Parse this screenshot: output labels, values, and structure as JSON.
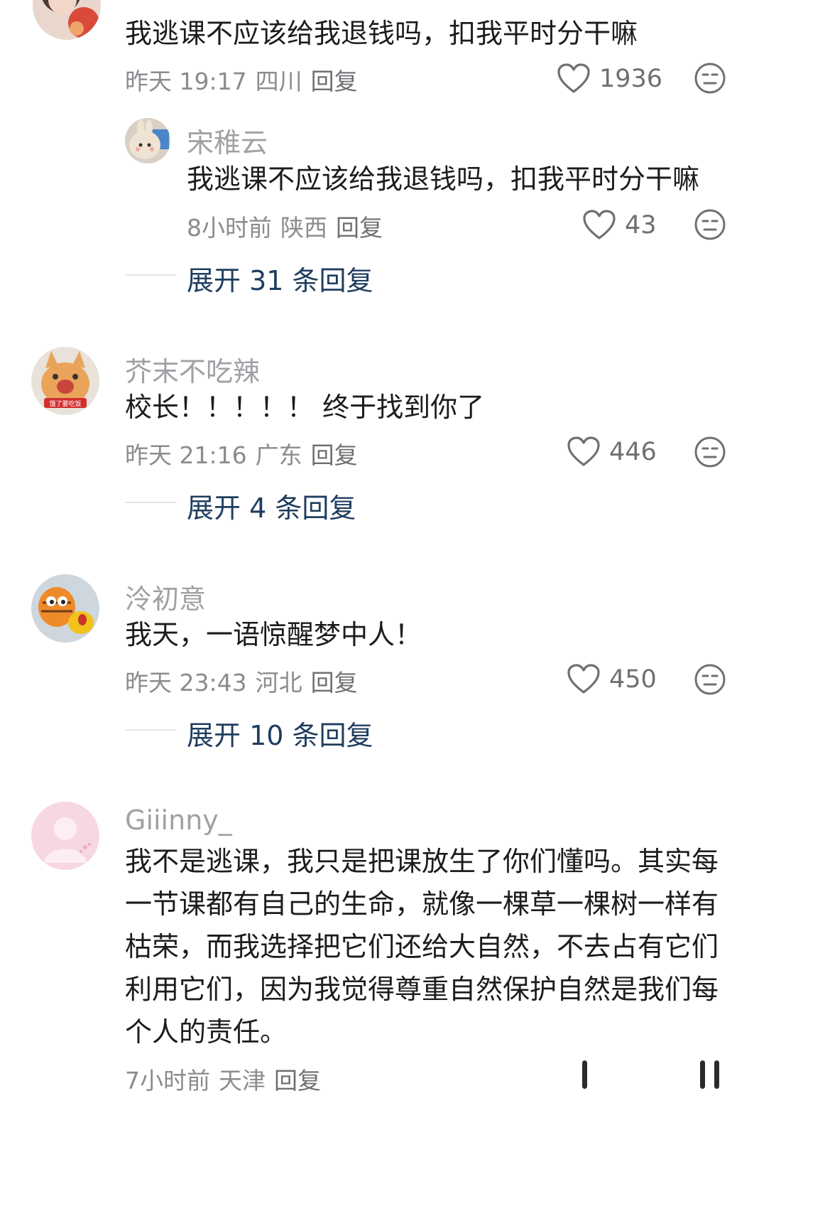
{
  "comments": [
    {
      "name": "",
      "text": "我逃课不应该给我退钱吗，扣我平时分干嘛",
      "time": "昨天 19:17",
      "location": "四川",
      "reply_label": "回复",
      "likes": "1936",
      "reply": {
        "name": "宋稚云",
        "text": "我逃课不应该给我退钱吗，扣我平时分干嘛",
        "time": "8小时前",
        "location": "陕西",
        "reply_label": "回复",
        "likes": "43"
      },
      "expand": "展开 31 条回复"
    },
    {
      "name": "芥末不吃辣",
      "avatar_caption": "饿了要吃饭",
      "text": "校长！！！！！ 终于找到你了",
      "time": "昨天 21:16",
      "location": "广东",
      "reply_label": "回复",
      "likes": "446",
      "expand": "展开 4 条回复"
    },
    {
      "name": "泠初意",
      "text": "我天，一语惊醒梦中人！",
      "time": "昨天 23:43",
      "location": "河北",
      "reply_label": "回复",
      "likes": "450",
      "expand": "展开 10 条回复"
    },
    {
      "name": "Giiinny_",
      "text_lines": [
        "我不是逃课，我只是把课放生了你们懂吗。其实每",
        "一节课都有自己的生命，就像一棵草一棵树一样有",
        "枯荣，而我选择把它们还给大自然，不去占有它们",
        "利用它们，因为我觉得尊重自然保护自然是我们每",
        "个人的责任。"
      ],
      "time": "7小时前",
      "location": "天津",
      "reply_label": "回复"
    }
  ],
  "icons": {
    "like": "heart-outline-icon",
    "dislike": "dislike-face-icon"
  },
  "colors": {
    "name_gray": "#a0a0a5",
    "meta_gray": "#8b8b90",
    "expand_blue": "#1f3d5e"
  }
}
